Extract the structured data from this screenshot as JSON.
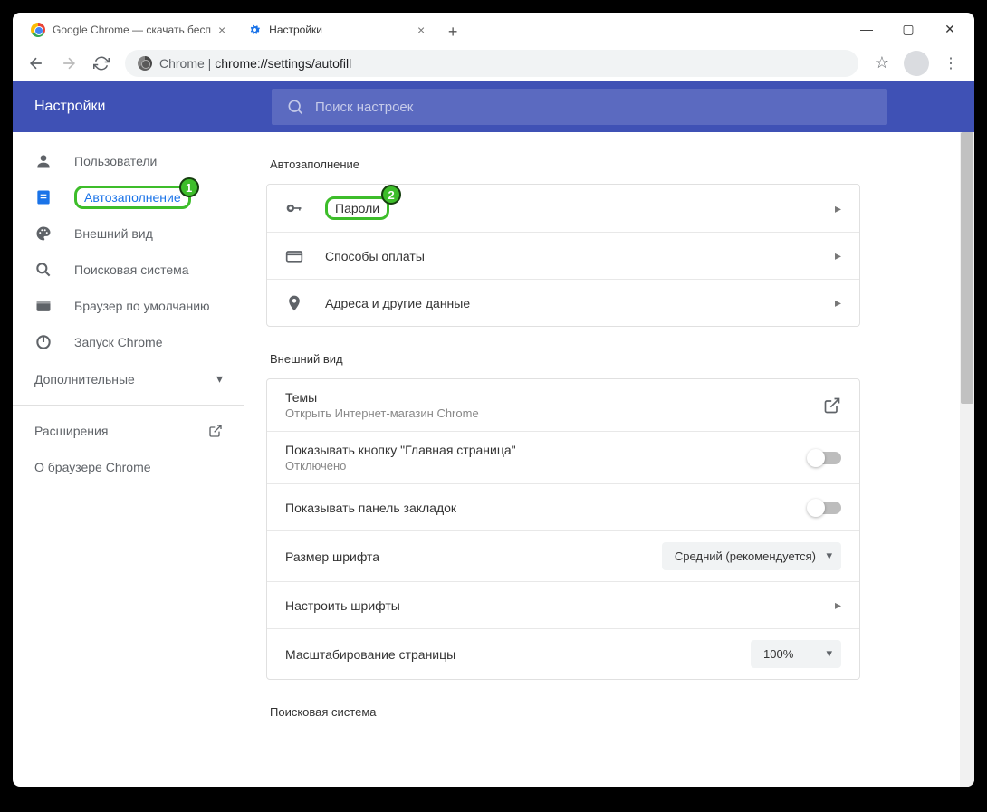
{
  "window": {
    "minimize": "—",
    "maximize": "▢",
    "close": "✕"
  },
  "tabs": [
    {
      "title": "Google Chrome — скачать бесп"
    },
    {
      "title": "Настройки"
    }
  ],
  "omnibox": {
    "scheme": "Chrome",
    "separator": " | ",
    "url": "chrome://settings/autofill"
  },
  "settings": {
    "title": "Настройки",
    "search_placeholder": "Поиск настроек"
  },
  "sidebar": {
    "items": [
      {
        "label": "Пользователи"
      },
      {
        "label": "Автозаполнение"
      },
      {
        "label": "Внешний вид"
      },
      {
        "label": "Поисковая система"
      },
      {
        "label": "Браузер по умолчанию"
      },
      {
        "label": "Запуск Chrome"
      }
    ],
    "advanced": "Дополнительные",
    "extensions": "Расширения",
    "about": "О браузере Chrome"
  },
  "sections": {
    "autofill_title": "Автозаполнение",
    "autofill_rows": [
      {
        "label": "Пароли"
      },
      {
        "label": "Способы оплаты"
      },
      {
        "label": "Адреса и другие данные"
      }
    ],
    "appearance_title": "Внешний вид",
    "appearance_rows": {
      "themes_label": "Темы",
      "themes_sub": "Открыть Интернет-магазин Chrome",
      "home_label": "Показывать кнопку \"Главная страница\"",
      "home_sub": "Отключено",
      "bookmarks_label": "Показывать панель закладок",
      "font_size_label": "Размер шрифта",
      "font_size_value": "Средний (рекомендуется)",
      "fonts_label": "Настроить шрифты",
      "zoom_label": "Масштабирование страницы",
      "zoom_value": "100%"
    },
    "search_title": "Поисковая система"
  },
  "annotations": {
    "badge1": "1",
    "badge2": "2"
  }
}
